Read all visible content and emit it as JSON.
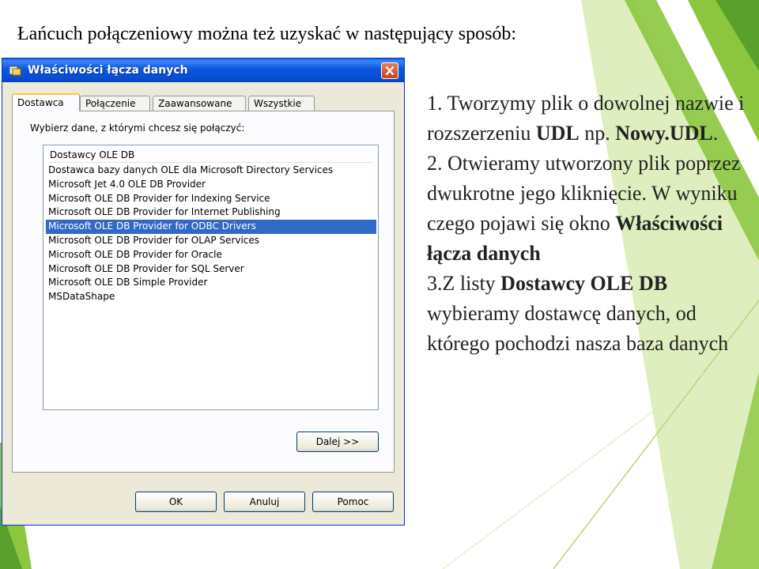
{
  "slide": {
    "title": "Łańcuch połączeniowy można też uzyskać w następujący sposób:",
    "steps": [
      {
        "a": "1. Tworzymy plik o dowolnej nazwie i rozszerzeniu ",
        "b": "UDL",
        "c": " np. ",
        "d": "Nowy.UDL",
        "e": "."
      },
      {
        "a": "2. Otwieramy utworzony plik poprzez dwukrotne jego kliknięcie. W wyniku czego pojawi się okno ",
        "b": "Właściwości łącza danych"
      },
      {
        "a": "3.Z listy ",
        "b": "Dostawcy OLE DB",
        "c": " wybieramy dostawcę danych, od którego pochodzi nasza baza danych"
      }
    ]
  },
  "dialog": {
    "title": "Właściwości łącza danych",
    "tabs": [
      "Dostawca",
      "Połączenie",
      "Zaawansowane",
      "Wszystkie"
    ],
    "active_tab": "Dostawca",
    "prompt": "Wybierz dane, z którymi chcesz się połączyć:",
    "list_header": "Dostawcy OLE DB",
    "providers": [
      "Dostawca bazy danych OLE dla Microsoft Directory Services",
      "Microsoft Jet 4.0 OLE DB Provider",
      "Microsoft OLE DB Provider for Indexing Service",
      "Microsoft OLE DB Provider for Internet Publishing",
      "Microsoft OLE DB Provider for ODBC Drivers",
      "Microsoft OLE DB Provider for OLAP Services",
      "Microsoft OLE DB Provider for Oracle",
      "Microsoft OLE DB Provider for SQL Server",
      "Microsoft OLE DB Simple Provider",
      "MSDataShape"
    ],
    "selected_provider": "Microsoft OLE DB Provider for ODBC Drivers",
    "next_button": "Dalej >>",
    "ok_button": "OK",
    "cancel_button": "Anuluj",
    "help_button": "Pomoc"
  },
  "colors": {
    "titlebar_blue": "#0650d6",
    "selection_blue": "#316ac5",
    "dialog_face": "#ece9d8",
    "decor_green": "#8cc63f",
    "decor_light_green": "#c5e08a"
  },
  "icons": {
    "title_icon": "data-link-icon",
    "close": "close-icon"
  }
}
